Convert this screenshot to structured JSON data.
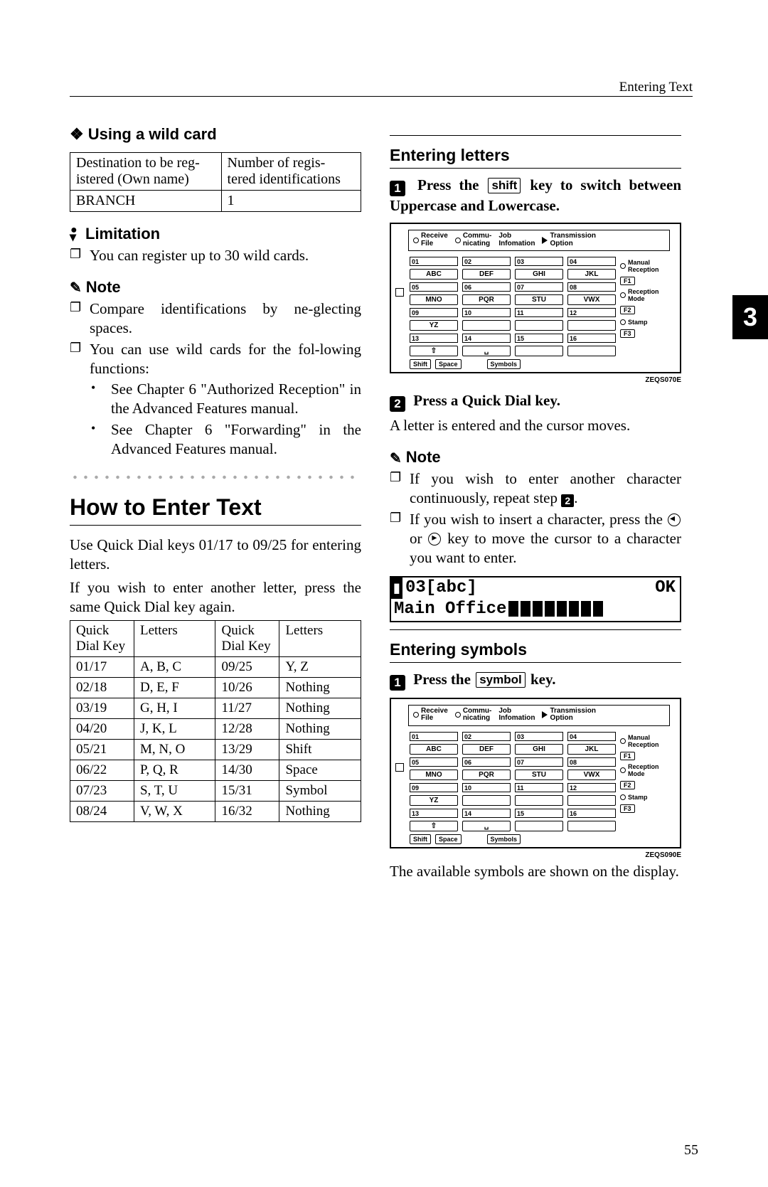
{
  "header": {
    "right": "Entering Text"
  },
  "side_tab": "3",
  "page_number": "55",
  "left": {
    "wildcard_heading": "Using a wild card",
    "wildcard_table": {
      "h1": "Destination to be reg-\nistered (Own name)",
      "h2": "Number of regis-\ntered identifications",
      "c1": "BRANCH",
      "c2": "1"
    },
    "limitation_heading": "Limitation",
    "limitation_text": "You can register up to 30 wild cards.",
    "note_heading": "Note",
    "note_items": [
      "Compare identifications by ne-glecting spaces.",
      "You can use wild cards for the fol-lowing functions:"
    ],
    "note_sub": [
      "See Chapter 6 \"Authorized Reception\" in the Advanced Features manual.",
      "See Chapter 6 \"Forwarding\" in the Advanced Features manual."
    ],
    "how_heading": "How to Enter Text",
    "how_p1": "Use Quick Dial keys 01/17 to 09/25 for entering letters.",
    "how_p2": "If you wish to enter another letter, press the same Quick Dial key again.",
    "letters_table": {
      "h1": "Quick Dial Key",
      "h2": "Letters",
      "h3": "Quick Dial Key",
      "h4": "Letters",
      "rows": [
        [
          "01/17",
          "A, B, C",
          "09/25",
          "Y, Z"
        ],
        [
          "02/18",
          "D, E, F",
          "10/26",
          "Nothing"
        ],
        [
          "03/19",
          "G, H, I",
          "11/27",
          "Nothing"
        ],
        [
          "04/20",
          "J, K, L",
          "12/28",
          "Nothing"
        ],
        [
          "05/21",
          "M, N, O",
          "13/29",
          "Shift"
        ],
        [
          "06/22",
          "P, Q, R",
          "14/30",
          "Space"
        ],
        [
          "07/23",
          "S, T, U",
          "15/31",
          "Symbol"
        ],
        [
          "08/24",
          "V, W, X",
          "16/32",
          "Nothing"
        ]
      ]
    }
  },
  "right": {
    "letters_heading": "Entering letters",
    "step1a": "Press the ",
    "step1_key": "shift",
    "step1b": " key to switch between Uppercase and Lowercase.",
    "kp_code1": "ZEQS070E",
    "step2_label": "Press a Quick Dial key.",
    "step2_text": "A letter is entered and the cursor moves.",
    "note_heading": "Note",
    "note_items": [
      "If you wish to enter another character continuously, repeat step ",
      "If you wish to insert a character, press the   or   key to move the cursor to a character you want to enter."
    ],
    "note1_suffix_num": "2",
    "lcd": {
      "line1_left": "03[abc]",
      "line1_right": "OK",
      "line2": "Main Office"
    },
    "symbols_heading": "Entering symbols",
    "sym_step1a": "Press the ",
    "sym_step1_key": "symbol",
    "sym_step1b": " key.",
    "kp_code2": "ZEQS090E",
    "sym_text": "The available symbols are shown on the display."
  },
  "keypad": {
    "top": {
      "receive": "Receive\nFile",
      "commu": "Commu-\nnicating",
      "job": "Job\nInfomation",
      "trans": "Transmission\nOption"
    },
    "nums_r1": [
      "01",
      "02",
      "03",
      "04"
    ],
    "keys_r1": [
      "ABC",
      "DEF",
      "GHI",
      "JKL"
    ],
    "nums_r2": [
      "05",
      "06",
      "07",
      "08"
    ],
    "keys_r2": [
      "MNO",
      "PQR",
      "STU",
      "VWX"
    ],
    "nums_r3": [
      "09",
      "10",
      "11",
      "12"
    ],
    "keys_r3": [
      "YZ",
      "",
      "",
      ""
    ],
    "nums_r4": [
      "13",
      "14",
      "15",
      "16"
    ],
    "sym_row": [
      "⇧",
      "␣",
      "",
      ""
    ],
    "bottom": [
      "Shift",
      "Space",
      "Symbols"
    ],
    "right": {
      "manual": "Manual\nReception",
      "f1": "F1",
      "recep": "Reception\nMode",
      "f2": "F2",
      "stamp": "Stamp",
      "f3": "F3"
    }
  }
}
